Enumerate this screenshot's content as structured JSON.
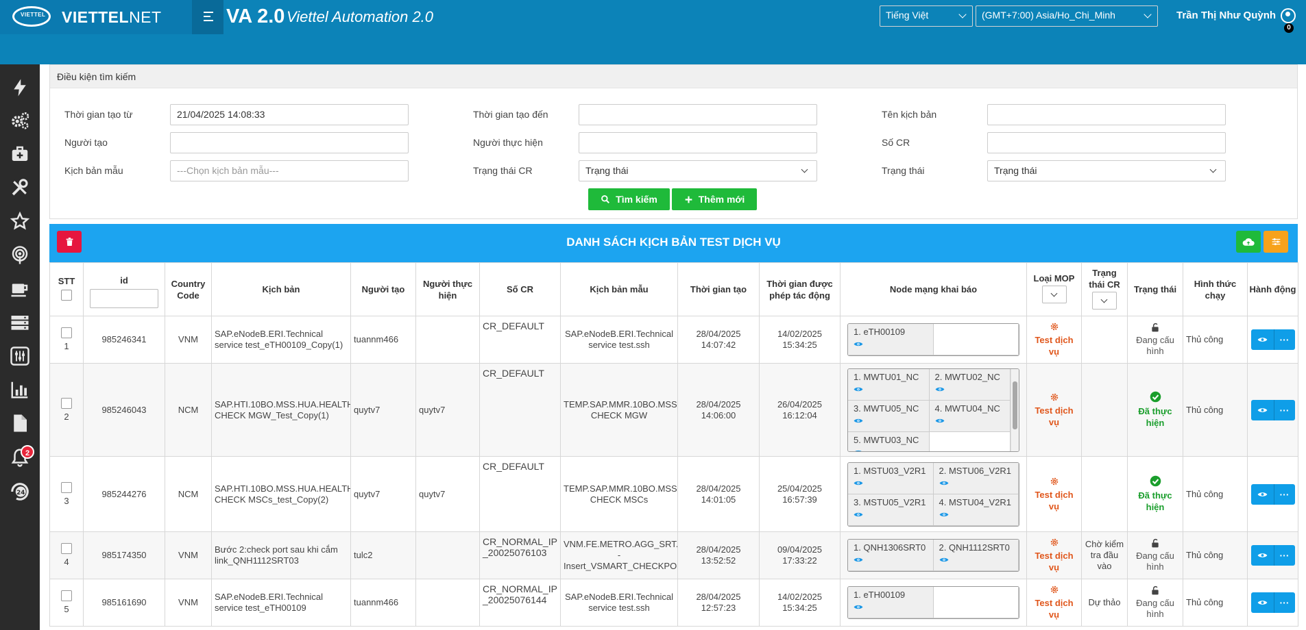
{
  "header": {
    "brand_logo_text": "VIETTEL",
    "brand_bold": "VIETTEL",
    "brand_light": "NET",
    "app_title": "VA 2.0",
    "app_subtitle": "Viettel Automation 2.0",
    "language": "Tiếng Việt",
    "timezone": "(GMT+7:00) Asia/Ho_Chi_Minh",
    "user_name": "Trần Thị Như Quỳnh",
    "user_badge": "0"
  },
  "sidebar": {
    "icons": [
      "flash-icon",
      "gears-icon",
      "toolbox-icon",
      "tools-icon",
      "star-icon",
      "podcast-icon",
      "coffee-icon",
      "server-icon",
      "sliders-icon",
      "bar-chart-icon",
      "document-icon",
      "bell-icon",
      "support-24-icon"
    ],
    "bell_badge": "2"
  },
  "search": {
    "title": "Điều kiện tìm kiếm",
    "created_from_label": "Thời gian tạo từ",
    "created_from_value": "21/04/2025 14:08:33",
    "created_to_label": "Thời gian tạo đến",
    "script_name_label": "Tên kịch bản",
    "creator_label": "Người tạo",
    "executor_label": "Người thực hiện",
    "cr_label": "Số CR",
    "template_label": "Kịch bản mẫu",
    "template_placeholder": "---Chọn kịch bản mẫu---",
    "cr_status_label": "Trạng thái CR",
    "cr_status_value": "Trạng thái",
    "status_label": "Trạng thái",
    "status_value": "Trạng thái",
    "search_button": "Tìm kiếm",
    "add_button": "Thêm mới"
  },
  "list": {
    "title": "DANH SÁCH KỊCH BẢN TEST DỊCH VỤ",
    "columns": {
      "stt": "STT",
      "id": "id",
      "country": "Country Code",
      "script": "Kịch bản",
      "creator": "Người tạo",
      "executor": "Người thực hiện",
      "cr": "Số CR",
      "template": "Kịch bản mẫu",
      "created": "Thời gian tạo",
      "allowed": "Thời gian được phép tác động",
      "nodes": "Node mạng khai báo",
      "mop": "Loại MOP",
      "cr_status": "Trạng thái CR",
      "status": "Trạng thái",
      "run_type": "Hình thức chạy",
      "action": "Hành động"
    },
    "rows": [
      {
        "stt": "1",
        "id": "985246341",
        "country": "VNM",
        "script": "SAP.eNodeB.ERI.Technical service test_eTH00109_Copy(1)",
        "creator": "tuannm466",
        "executor": "",
        "cr": "CR_DEFAULT",
        "template": "SAP.eNodeB.ERI.Technical service test.ssh",
        "created": "28/04/2025 14:07:42",
        "allowed": "14/02/2025 15:34:25",
        "nodes": [
          "1. eTH00109"
        ],
        "mop": "Test dịch vụ",
        "cr_status": "",
        "status": "Đang cấu hình",
        "status_type": "config",
        "run_type": "Thủ công"
      },
      {
        "stt": "2",
        "id": "985246043",
        "country": "NCM",
        "script": "SAP.HTI.10BO.MSS.HUA.HEALTH CHECK MGW_Test_Copy(1)",
        "creator": "quytv7",
        "executor": "quytv7",
        "cr": "CR_DEFAULT",
        "template": "TEMP.SAP.MMR.10BO.MSS CHECK MGW",
        "created": "28/04/2025 14:06:00",
        "allowed": "26/04/2025 16:12:04",
        "nodes": [
          "1. MWTU01_NC",
          "2. MWTU02_NC",
          "3. MWTU05_NC",
          "4. MWTU04_NC",
          "5. MWTU03_NC"
        ],
        "mop": "Test dịch vụ",
        "cr_status": "",
        "status": "Đã thực hiện",
        "status_type": "done",
        "run_type": "Thủ công"
      },
      {
        "stt": "3",
        "id": "985244276",
        "country": "NCM",
        "script": "SAP.HTI.10BO.MSS.HUA.HEALTH CHECK MSCs_test_Copy(2)",
        "creator": "quytv7",
        "executor": "quytv7",
        "cr": "CR_DEFAULT",
        "template": "TEMP.SAP.MMR.10BO.MSS CHECK MSCs",
        "created": "28/04/2025 14:01:05",
        "allowed": "25/04/2025 16:57:39",
        "nodes": [
          "1. MSTU03_V2R1",
          "2. MSTU06_V2R1",
          "3. MSTU05_V2R1",
          "4. MSTU04_V2R1"
        ],
        "mop": "Test dịch vụ",
        "cr_status": "",
        "status": "Đã thực hiện",
        "status_type": "done",
        "run_type": "Thủ công"
      },
      {
        "stt": "4",
        "id": "985174350",
        "country": "VNM",
        "script": "Bước 2:check port sau khi cắm link_QNH1112SRT03",
        "creator": "tulc2",
        "executor": "",
        "cr": "CR_NORMAL_IP_20025076103",
        "template": "VNM.FE.METRO.AGG_SRT.SRT - Insert_VSMART_CHECKPO",
        "created": "28/04/2025 13:52:52",
        "allowed": "09/04/2025 17:33:22",
        "nodes": [
          "1. QNH1306SRT0",
          "2. QNH1112SRT0"
        ],
        "mop": "Test dịch vụ",
        "cr_status": "Chờ kiểm tra đầu vào",
        "status": "Đang cấu hình",
        "status_type": "config",
        "run_type": "Thủ công"
      },
      {
        "stt": "5",
        "id": "985161690",
        "country": "VNM",
        "script": "SAP.eNodeB.ERI.Technical service test_eTH00109",
        "creator": "tuannm466",
        "executor": "",
        "cr": "CR_NORMAL_IP_20025076144",
        "template": "SAP.eNodeB.ERI.Technical service test.ssh",
        "created": "28/04/2025 12:57:23",
        "allowed": "14/02/2025 15:34:25",
        "nodes": [
          "1. eTH00109"
        ],
        "mop": "Test dịch vụ",
        "cr_status": "Dự thảo",
        "status": "Đang cấu hình",
        "status_type": "config",
        "run_type": "Thủ công"
      }
    ]
  },
  "colors": {
    "header_bg": "#0c83b8",
    "sidebar_bg": "#2b2b2b",
    "list_bar": "#1ca4f0",
    "green_button": "#1fba3a",
    "delete_button": "#e6163e",
    "upload_button": "#1fba3a",
    "settings_button": "#f7a21b",
    "mop_orange": "#e0561b",
    "done_green": "#1a9e2c"
  }
}
